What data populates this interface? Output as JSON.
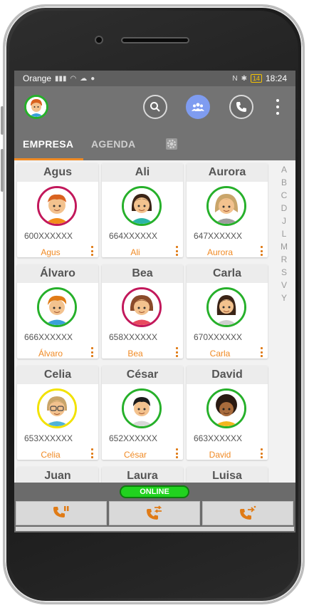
{
  "status_bar": {
    "carrier": "Orange",
    "time": "18:24",
    "battery": "14"
  },
  "app_bar": {
    "icons": [
      "user-avatar-icon",
      "search-icon",
      "group-icon",
      "phone-icon",
      "more-vert-icon"
    ],
    "accent_color": "#7f9cf0"
  },
  "tabs": [
    {
      "label": "EMPRESA",
      "active": true
    },
    {
      "label": "AGENDA",
      "active": false
    }
  ],
  "contacts": [
    {
      "name": "Agus",
      "phone": "600XXXXXX",
      "ring": "#c2185b"
    },
    {
      "name": "Ali",
      "phone": "664XXXXXX",
      "ring": "#26b02a"
    },
    {
      "name": "Aurora",
      "phone": "647XXXXXX",
      "ring": "#26b02a"
    },
    {
      "name": "Álvaro",
      "phone": "666XXXXXX",
      "ring": "#26b02a"
    },
    {
      "name": "Bea",
      "phone": "658XXXXXX",
      "ring": "#c2185b"
    },
    {
      "name": "Carla",
      "phone": "670XXXXXX",
      "ring": "#26b02a"
    },
    {
      "name": "Celia",
      "phone": "653XXXXXX",
      "ring": "#f2e200"
    },
    {
      "name": "César",
      "phone": "652XXXXXX",
      "ring": "#26b02a"
    },
    {
      "name": "David",
      "phone": "663XXXXXX",
      "ring": "#26b02a"
    },
    {
      "name": "Juan",
      "phone": "",
      "ring": "#26b02a"
    },
    {
      "name": "Laura",
      "phone": "",
      "ring": "#26b02a"
    },
    {
      "name": "Luisa",
      "phone": "",
      "ring": "#26b02a"
    }
  ],
  "alphabet": [
    "A",
    "B",
    "C",
    "D",
    "J",
    "L",
    "M",
    "R",
    "S",
    "V",
    "Y"
  ],
  "status": {
    "label": "ONLINE",
    "color": "#21d21f"
  },
  "call_actions": [
    "call-hold-icon",
    "call-transfer-icon",
    "call-forward-icon"
  ]
}
